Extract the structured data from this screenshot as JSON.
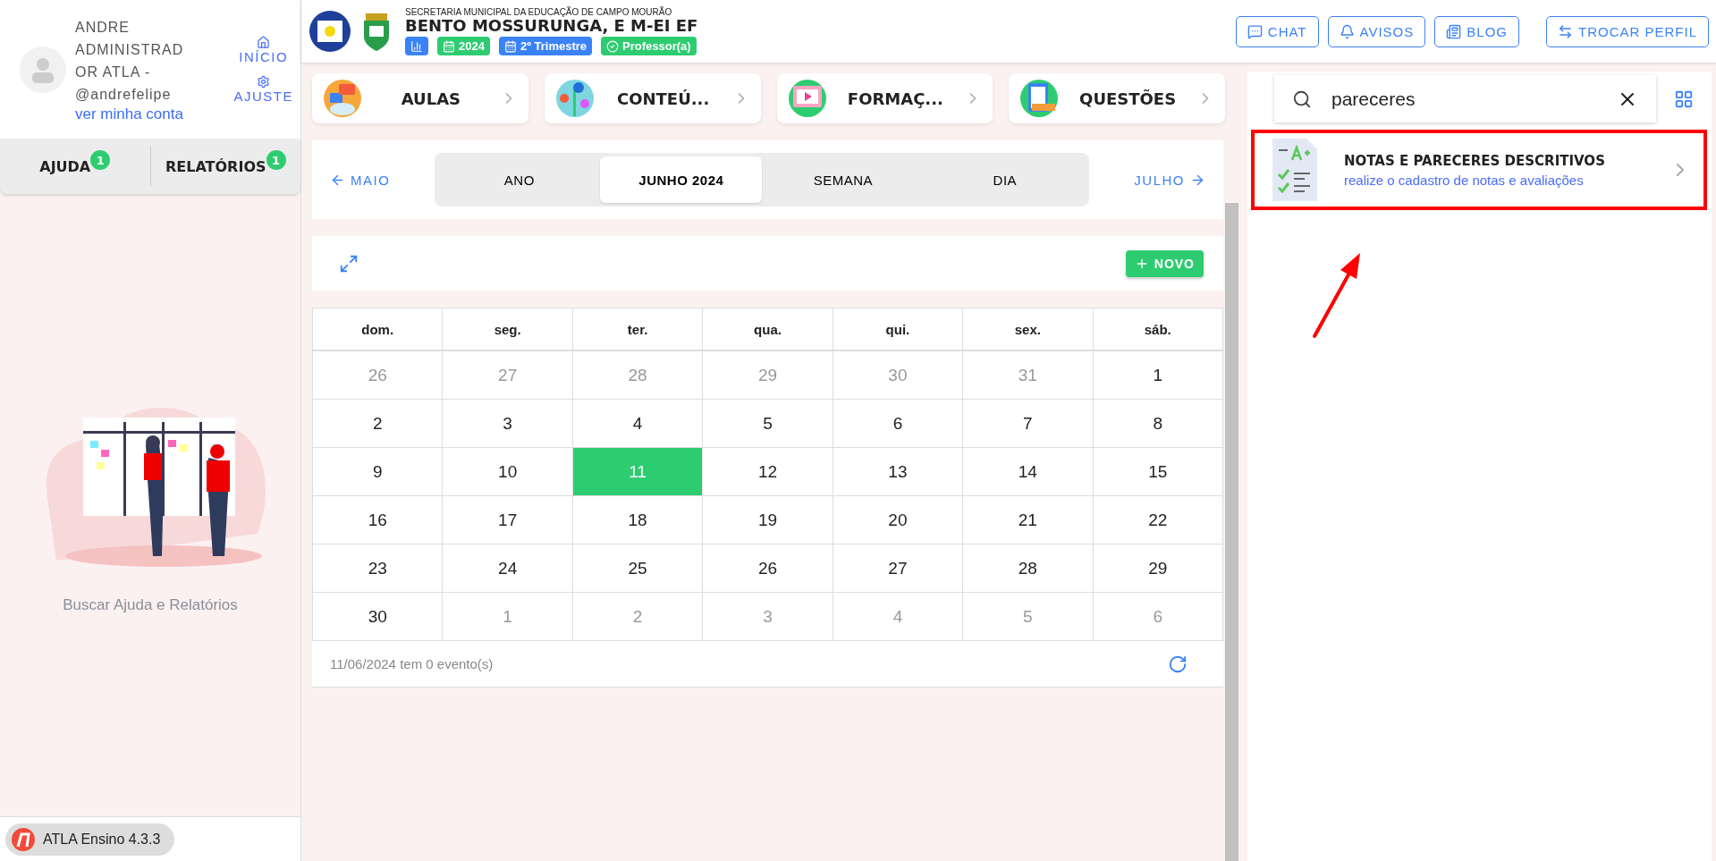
{
  "user": {
    "name": "ANDRE ADMINISTRAD OR ATLA - @andrefelipe",
    "account_link": "ver minha conta"
  },
  "side_links": [
    {
      "label": "INÍCIO",
      "kind": "home"
    },
    {
      "label": "AJUSTE",
      "kind": "settings"
    }
  ],
  "side_tabs": [
    {
      "label": "AJUDA",
      "badge": "1"
    },
    {
      "label": "RELATÓRIOS",
      "badge": "1"
    }
  ],
  "side_caption": "Buscar Ajuda e Relatórios",
  "version": "ATLA Ensino 4.3.3",
  "header": {
    "org": "SECRETARIA MUNICIPAL DA EDUCAÇÃO DE CAMPO MOURÃO",
    "school": "BENTO MOSSURUNGA, E M-EI EF",
    "badges": [
      {
        "kind": "chart",
        "color": "#3b82f6"
      },
      {
        "kind": "calendar",
        "label": "2024",
        "color": "#2ecc71"
      },
      {
        "kind": "calendar",
        "label": "2º Trimestre",
        "color": "#3b82f6"
      },
      {
        "kind": "check",
        "label": "Professor(a)",
        "color": "#2ecc71"
      }
    ],
    "buttons": [
      {
        "label": "CHAT",
        "kind": "chat"
      },
      {
        "label": "AVISOS",
        "kind": "bell"
      },
      {
        "label": "BLOG",
        "kind": "news"
      },
      {
        "label": "TROCAR PERFIL",
        "kind": "swap"
      }
    ]
  },
  "quick_cards": [
    {
      "label": "AULAS",
      "kind": "lessons"
    },
    {
      "label": "CONTEÚ...",
      "kind": "content"
    },
    {
      "label": "FORMAÇ...",
      "kind": "video"
    },
    {
      "label": "QUESTÕES",
      "kind": "questions"
    }
  ],
  "calendar": {
    "prev": "MAIO",
    "next": "JULHO",
    "views": [
      {
        "label": "ANO",
        "selected": false
      },
      {
        "label": "JUNHO 2024",
        "selected": true
      },
      {
        "label": "SEMANA",
        "selected": false
      },
      {
        "label": "DIA",
        "selected": false
      }
    ],
    "new_button": "NOVO",
    "weekdays": [
      "dom.",
      "seg.",
      "ter.",
      "qua.",
      "qui.",
      "sex.",
      "sáb."
    ],
    "weeks": [
      [
        {
          "day": "26",
          "outside": true,
          "selected": false
        },
        {
          "day": "27",
          "outside": true,
          "selected": false
        },
        {
          "day": "28",
          "outside": true,
          "selected": false
        },
        {
          "day": "29",
          "outside": true,
          "selected": false
        },
        {
          "day": "30",
          "outside": true,
          "selected": false
        },
        {
          "day": "31",
          "outside": true,
          "selected": false
        },
        {
          "day": "1",
          "outside": false,
          "selected": false
        }
      ],
      [
        {
          "day": "2",
          "outside": false,
          "selected": false
        },
        {
          "day": "3",
          "outside": false,
          "selected": false
        },
        {
          "day": "4",
          "outside": false,
          "selected": false
        },
        {
          "day": "5",
          "outside": false,
          "selected": false
        },
        {
          "day": "6",
          "outside": false,
          "selected": false
        },
        {
          "day": "7",
          "outside": false,
          "selected": false
        },
        {
          "day": "8",
          "outside": false,
          "selected": false
        }
      ],
      [
        {
          "day": "9",
          "outside": false,
          "selected": false
        },
        {
          "day": "10",
          "outside": false,
          "selected": false
        },
        {
          "day": "11",
          "outside": false,
          "selected": true
        },
        {
          "day": "12",
          "outside": false,
          "selected": false
        },
        {
          "day": "13",
          "outside": false,
          "selected": false
        },
        {
          "day": "14",
          "outside": false,
          "selected": false
        },
        {
          "day": "15",
          "outside": false,
          "selected": false
        }
      ],
      [
        {
          "day": "16",
          "outside": false,
          "selected": false
        },
        {
          "day": "17",
          "outside": false,
          "selected": false
        },
        {
          "day": "18",
          "outside": false,
          "selected": false
        },
        {
          "day": "19",
          "outside": false,
          "selected": false
        },
        {
          "day": "20",
          "outside": false,
          "selected": false
        },
        {
          "day": "21",
          "outside": false,
          "selected": false
        },
        {
          "day": "22",
          "outside": false,
          "selected": false
        }
      ],
      [
        {
          "day": "23",
          "outside": false,
          "selected": false
        },
        {
          "day": "24",
          "outside": false,
          "selected": false
        },
        {
          "day": "25",
          "outside": false,
          "selected": false
        },
        {
          "day": "26",
          "outside": false,
          "selected": false
        },
        {
          "day": "27",
          "outside": false,
          "selected": false
        },
        {
          "day": "28",
          "outside": false,
          "selected": false
        },
        {
          "day": "29",
          "outside": false,
          "selected": false
        }
      ],
      [
        {
          "day": "30",
          "outside": false,
          "selected": false
        },
        {
          "day": "1",
          "outside": true,
          "selected": false
        },
        {
          "day": "2",
          "outside": true,
          "selected": false
        },
        {
          "day": "3",
          "outside": true,
          "selected": false
        },
        {
          "day": "4",
          "outside": true,
          "selected": false
        },
        {
          "day": "5",
          "outside": true,
          "selected": false
        },
        {
          "day": "6",
          "outside": true,
          "selected": false
        }
      ]
    ],
    "footer": "11/06/2024 tem 0 evento(s)"
  },
  "search": {
    "value": "pareceres"
  },
  "results": [
    {
      "title": "NOTAS E PARECERES DESCRITIVOS",
      "subtitle": "realize o cadastro de notas e avaliações",
      "highlighted": true
    }
  ]
}
